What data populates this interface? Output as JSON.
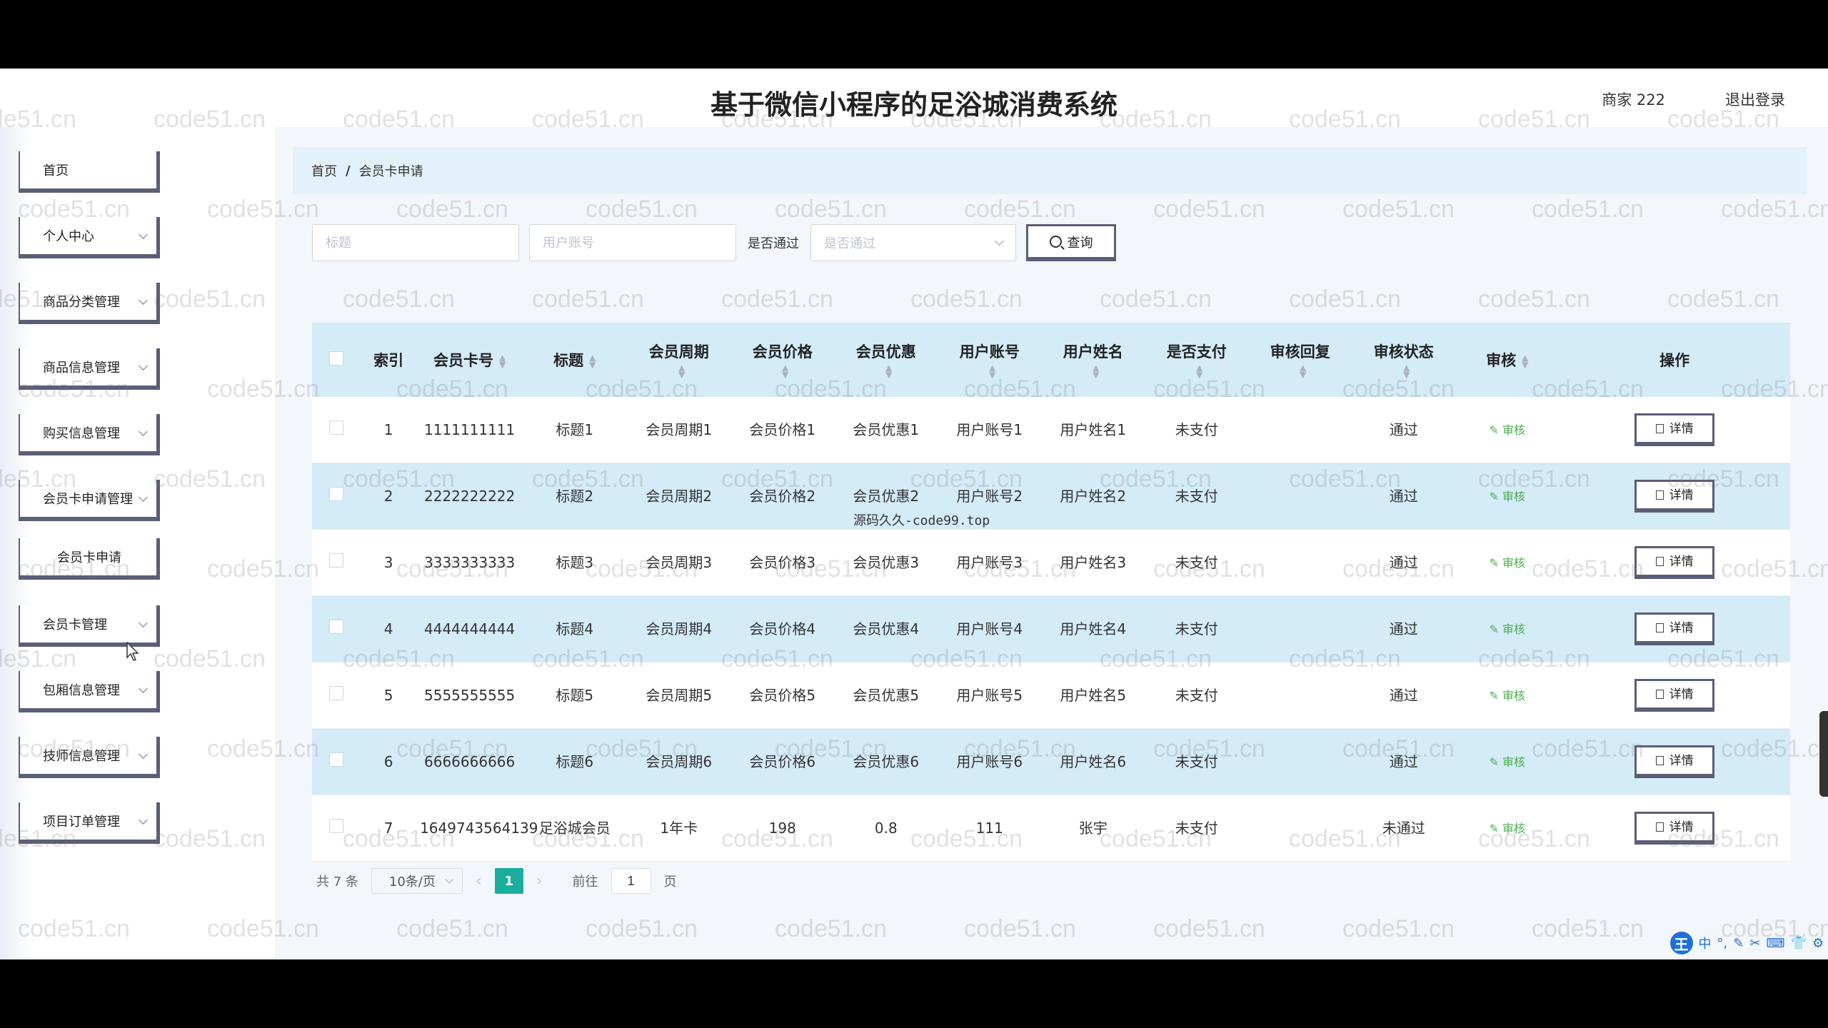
{
  "header": {
    "title": "基于微信小程序的足浴城消费系统",
    "user": "商家 222",
    "logout": "退出登录"
  },
  "sidebar": {
    "items": [
      {
        "label": "首页",
        "chevron": false
      },
      {
        "label": "个人中心",
        "chevron": true
      },
      {
        "label": "商品分类管理",
        "chevron": true
      },
      {
        "label": "商品信息管理",
        "chevron": true
      },
      {
        "label": "购买信息管理",
        "chevron": true
      },
      {
        "label": "会员卡申请管理",
        "chevron": true
      },
      {
        "label": "会员卡申请",
        "chevron": false,
        "sub": true
      },
      {
        "label": "会员卡管理",
        "chevron": true
      },
      {
        "label": "包厢信息管理",
        "chevron": true
      },
      {
        "label": "技师信息管理",
        "chevron": true
      },
      {
        "label": "项目订单管理",
        "chevron": true
      }
    ]
  },
  "breadcrumb": {
    "home": "首页",
    "sep": "/",
    "current": "会员卡申请"
  },
  "search": {
    "title_placeholder": "标题",
    "account_placeholder": "用户账号",
    "pass_label": "是否通过",
    "pass_placeholder": "是否通过",
    "query_label": "查询"
  },
  "table": {
    "columns": [
      "索引",
      "会员卡号",
      "标题",
      "会员周期",
      "会员价格",
      "会员优惠",
      "用户账号",
      "用户姓名",
      "是否支付",
      "审核回复",
      "审核状态",
      "审核",
      "操作"
    ],
    "audit_label": "审核",
    "detail_label": "详情",
    "rows": [
      {
        "idx": "1",
        "card": "1111111111",
        "title": "标题1",
        "period": "会员周期1",
        "price": "会员价格1",
        "discount": "会员优惠1",
        "account": "用户账号1",
        "name": "用户姓名1",
        "paid": "未支付",
        "reply": "",
        "status": "通过"
      },
      {
        "idx": "2",
        "card": "2222222222",
        "title": "标题2",
        "period": "会员周期2",
        "price": "会员价格2",
        "discount": "会员优惠2",
        "account": "用户账号2",
        "name": "用户姓名2",
        "paid": "未支付",
        "reply": "",
        "status": "通过"
      },
      {
        "idx": "3",
        "card": "3333333333",
        "title": "标题3",
        "period": "会员周期3",
        "price": "会员价格3",
        "discount": "会员优惠3",
        "account": "用户账号3",
        "name": "用户姓名3",
        "paid": "未支付",
        "reply": "",
        "status": "通过"
      },
      {
        "idx": "4",
        "card": "4444444444",
        "title": "标题4",
        "period": "会员周期4",
        "price": "会员价格4",
        "discount": "会员优惠4",
        "account": "用户账号4",
        "name": "用户姓名4",
        "paid": "未支付",
        "reply": "",
        "status": "通过"
      },
      {
        "idx": "5",
        "card": "5555555555",
        "title": "标题5",
        "period": "会员周期5",
        "price": "会员价格5",
        "discount": "会员优惠5",
        "account": "用户账号5",
        "name": "用户姓名5",
        "paid": "未支付",
        "reply": "",
        "status": "通过"
      },
      {
        "idx": "6",
        "card": "6666666666",
        "title": "标题6",
        "period": "会员周期6",
        "price": "会员价格6",
        "discount": "会员优惠6",
        "account": "用户账号6",
        "name": "用户姓名6",
        "paid": "未支付",
        "reply": "",
        "status": "通过"
      },
      {
        "idx": "7",
        "card": "1649743564139",
        "title": "足浴城会员",
        "period": "1年卡",
        "price": "198",
        "discount": "0.8",
        "account": "111",
        "name": "张宇",
        "paid": "未支付",
        "reply": "",
        "status": "未通过"
      }
    ]
  },
  "pager": {
    "total": "共 7 条",
    "page_size": "10条/页",
    "current_page": "1",
    "goto_label": "前往",
    "goto_value": "1",
    "page_suffix": "页"
  },
  "overlay_text": "源码久久-code99.top",
  "watermark": "code51.cn",
  "ime": {
    "logo": "王",
    "mode": "中"
  }
}
